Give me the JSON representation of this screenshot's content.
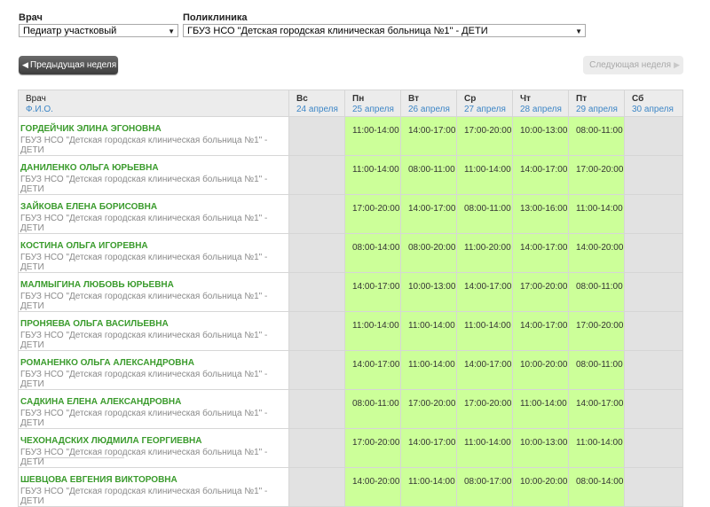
{
  "filters": {
    "doctor_label": "Врач",
    "doctor_value": "Педиатр участковый",
    "clinic_label": "Поликлиника",
    "clinic_value": "ГБУЗ НСО \"Детская городская клиническая больница №1\" - ДЕТИ"
  },
  "nav": {
    "prev_label": "Предыдущая неделя",
    "next_label": "Следующая неделя"
  },
  "table": {
    "header_doctor": "Врач",
    "header_fio": "Ф.И.О.",
    "days": [
      {
        "day": "Вс",
        "date": "24 апреля"
      },
      {
        "day": "Пн",
        "date": "25 апреля"
      },
      {
        "day": "Вт",
        "date": "26 апреля"
      },
      {
        "day": "Ср",
        "date": "27 апреля"
      },
      {
        "day": "Чт",
        "date": "28 апреля"
      },
      {
        "day": "Пт",
        "date": "29 апреля"
      },
      {
        "day": "Сб",
        "date": "30 апреля"
      }
    ],
    "rows": [
      {
        "name": "ГОРДЕЙЧИК ЭЛИНА ЭГОНОВНА",
        "clinic": "ГБУЗ НСО \"Детская городская клиническая больница №1\" - ДЕТИ",
        "slots": [
          "",
          "11:00-14:00",
          "14:00-17:00",
          "17:00-20:00",
          "10:00-13:00",
          "08:00-11:00",
          ""
        ]
      },
      {
        "name": "ДАНИЛЕНКО ОЛЬГА ЮРЬЕВНА",
        "clinic": "ГБУЗ НСО \"Детская городская клиническая больница №1\" - ДЕТИ",
        "slots": [
          "",
          "11:00-14:00",
          "08:00-11:00",
          "11:00-14:00",
          "14:00-17:00",
          "17:00-20:00",
          ""
        ]
      },
      {
        "name": "ЗАЙКОВА ЕЛЕНА БОРИСОВНА",
        "clinic": "ГБУЗ НСО \"Детская городская клиническая больница №1\" - ДЕТИ",
        "slots": [
          "",
          "17:00-20:00",
          "14:00-17:00",
          "08:00-11:00",
          "13:00-16:00",
          "11:00-14:00",
          ""
        ]
      },
      {
        "name": "КОСТИНА ОЛЬГА ИГОРЕВНА",
        "clinic": "ГБУЗ НСО \"Детская городская клиническая больница №1\" - ДЕТИ",
        "slots": [
          "",
          "08:00-14:00",
          "08:00-20:00",
          "11:00-20:00",
          "14:00-17:00",
          "14:00-20:00",
          ""
        ]
      },
      {
        "name": "МАЛМЫГИНА ЛЮБОВЬ ЮРЬЕВНА",
        "clinic": "ГБУЗ НСО \"Детская городская клиническая больница №1\" - ДЕТИ",
        "slots": [
          "",
          "14:00-17:00",
          "10:00-13:00",
          "14:00-17:00",
          "17:00-20:00",
          "08:00-11:00",
          ""
        ]
      },
      {
        "name": "ПРОНЯЕВА ОЛЬГА ВАСИЛЬЕВНА",
        "clinic": "ГБУЗ НСО \"Детская городская клиническая больница №1\" - ДЕТИ",
        "slots": [
          "",
          "11:00-14:00",
          "11:00-14:00",
          "11:00-14:00",
          "14:00-17:00",
          "17:00-20:00",
          ""
        ]
      },
      {
        "name": "РОМАНЕНКО ОЛЬГА АЛЕКСАНДРОВНА",
        "clinic": "ГБУЗ НСО \"Детская городская клиническая больница №1\" - ДЕТИ",
        "slots": [
          "",
          "14:00-17:00",
          "11:00-14:00",
          "14:00-17:00",
          "10:00-20:00",
          "08:00-11:00",
          ""
        ]
      },
      {
        "name": "САДКИНА ЕЛЕНА АЛЕКСАНДРОВНА",
        "clinic": "ГБУЗ НСО \"Детская городская клиническая больница №1\" - ДЕТИ",
        "slots": [
          "",
          "08:00-11:00",
          "17:00-20:00",
          "17:00-20:00",
          "11:00-14:00",
          "14:00-17:00",
          ""
        ]
      },
      {
        "name": "ЧЕХОНАДСКИХ ЛЮДМИЛА ГЕОРГИЕВНА",
        "clinic": "ГБУЗ НСО \"Детская городская клиническая больница №1\" - ДЕТИ",
        "slots": [
          "",
          "17:00-20:00",
          "14:00-17:00",
          "11:00-14:00",
          "10:00-13:00",
          "11:00-14:00",
          ""
        ]
      },
      {
        "name": "ШЕВЦОВА ЕВГЕНИЯ ВИКТОРОВНА",
        "clinic": "ГБУЗ НСО \"Детская городская клиническая больница №1\" - ДЕТИ",
        "slots": [
          "",
          "14:00-20:00",
          "11:00-14:00",
          "08:00-17:00",
          "10:00-20:00",
          "08:00-14:00",
          ""
        ]
      }
    ]
  },
  "colors": {
    "available_cell": "#ccff99",
    "unavailable_cell": "#e2e2e2",
    "doctor_name": "#3a9b2c",
    "date_link": "#3d86c6"
  },
  "icons": {
    "select_arrow": "triangle-down-icon",
    "prev": "chevron-left-icon",
    "next": "chevron-right-icon"
  }
}
